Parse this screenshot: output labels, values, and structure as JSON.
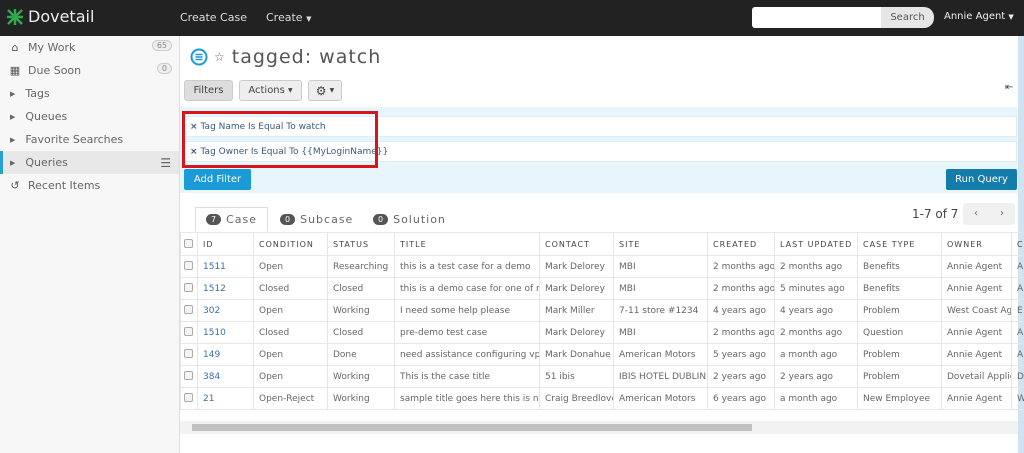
{
  "topbar": {
    "brand": "Dovetail",
    "nav": [
      "Create Case",
      "Create"
    ],
    "search_placeholder": "",
    "search_button": "Search",
    "user": "Annie Agent"
  },
  "sidebar": {
    "items": [
      {
        "label": "My Work",
        "icon": "home-icon",
        "badge": "65"
      },
      {
        "label": "Due Soon",
        "icon": "calendar-icon",
        "badge": "0"
      },
      {
        "label": "Tags",
        "icon": "caret-right-icon"
      },
      {
        "label": "Queues",
        "icon": "caret-right-icon"
      },
      {
        "label": "Favorite Searches",
        "icon": "caret-right-icon"
      },
      {
        "label": "Queries",
        "icon": "caret-right-icon",
        "active": true
      },
      {
        "label": "Recent Items",
        "icon": "history-icon"
      }
    ]
  },
  "page": {
    "title": "tagged: watch",
    "filters_label": "Filters",
    "actions_label": "Actions",
    "add_filter": "Add Filter",
    "run_query": "Run Query",
    "filters": [
      "Tag Name Is Equal To watch",
      "Tag Owner Is Equal To {{MyLoginName}}"
    ]
  },
  "tabs": [
    {
      "count": "7",
      "label": "Case",
      "active": true
    },
    {
      "count": "0",
      "label": "Subcase"
    },
    {
      "count": "0",
      "label": "Solution"
    }
  ],
  "pager": {
    "text": "1-7 of 7"
  },
  "table": {
    "columns": [
      "ID",
      "CONDITION",
      "STATUS",
      "TITLE",
      "CONTACT",
      "SITE",
      "CREATED",
      "LAST UPDATED",
      "CASE TYPE",
      "OWNER",
      "C"
    ],
    "rows": [
      [
        "1511",
        "Open",
        "Researching",
        "this is a test case for a demo",
        "Mark Delorey",
        "MBI",
        "2 months ago",
        "2 months ago",
        "Benefits",
        "Annie Agent",
        "A"
      ],
      [
        "1512",
        "Closed",
        "Closed",
        "this is a demo case for one of my f",
        "Mark Delorey",
        "MBI",
        "2 months ago",
        "5 minutes ago",
        "Benefits",
        "Annie Agent",
        "A"
      ],
      [
        "302",
        "Open",
        "Working",
        "I need some help please",
        "Mark Miller",
        "7-11 store #1234",
        "4 years ago",
        "4 years ago",
        "Problem",
        "West Coast Age",
        "E"
      ],
      [
        "1510",
        "Closed",
        "Closed",
        "pre-demo test case",
        "Mark Delorey",
        "MBI",
        "2 months ago",
        "2 months ago",
        "Question",
        "Annie Agent",
        "A"
      ],
      [
        "149",
        "Open",
        "Done",
        "need assistance configuring vpn.",
        "Mark Donahue",
        "American Motors",
        "5 years ago",
        "a month ago",
        "Problem",
        "Annie Agent",
        "A"
      ],
      [
        "384",
        "Open",
        "Working",
        "This is the case title",
        "51 ibis",
        "IBIS HOTEL DUBLIN",
        "2 years ago",
        "2 years ago",
        "Problem",
        "Dovetail Applica",
        "D"
      ],
      [
        "21",
        "Open-Reject",
        "Working",
        "sample title goes here this is new",
        "Craig Breedlove",
        "American Motors",
        "6 years ago",
        "a month ago",
        "New Employee",
        "Annie Agent",
        "W"
      ]
    ]
  },
  "colors": {
    "topbar": "#222222",
    "accent": "#1a9bd7",
    "run_query": "#137cab",
    "highlight_box": "#d9141c",
    "filter_panel": "#e6f6fc"
  }
}
